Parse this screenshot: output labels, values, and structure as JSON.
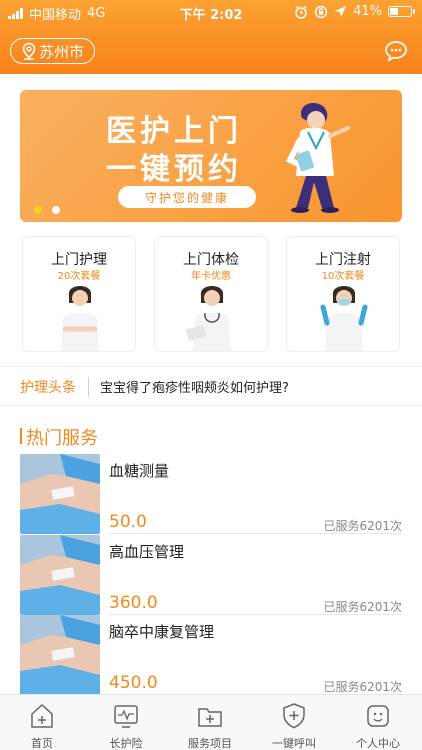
{
  "status_bar": {
    "carrier": "中国移动",
    "network": "4G",
    "time": "下午 2:02",
    "battery": "41%",
    "battery_fraction": 0.41
  },
  "header": {
    "city": "苏州市"
  },
  "banner": {
    "title_line1": "医护上门",
    "title_line2": "一键预约",
    "slogan": "守护您的健康",
    "slide_count": 2,
    "active_slide": 0
  },
  "service_cards": [
    {
      "title": "上门护理",
      "subtitle": "20次套餐"
    },
    {
      "title": "上门体检",
      "subtitle": "年卡优惠"
    },
    {
      "title": "上门注射",
      "subtitle": "10次套餐"
    }
  ],
  "headlines": {
    "tag": "护理头条",
    "text": "宝宝得了疱疹性咽颊炎如何护理?"
  },
  "hot_services": {
    "title": "热门服务",
    "items": [
      {
        "name": "血糖测量",
        "price": "50.0",
        "served": "已服务6201次"
      },
      {
        "name": "高血压管理",
        "price": "360.0",
        "served": "已服务6201次"
      },
      {
        "name": "脑卒中康复管理",
        "price": "450.0",
        "served": "已服务6201次"
      }
    ]
  },
  "tabbar": [
    {
      "label": "首页",
      "icon": "home-icon"
    },
    {
      "label": "长护险",
      "icon": "monitor-icon"
    },
    {
      "label": "服务项目",
      "icon": "folder-icon"
    },
    {
      "label": "一键呼叫",
      "icon": "shield-icon"
    },
    {
      "label": "个人中心",
      "icon": "profile-icon"
    }
  ],
  "colors": {
    "brand_orange": "#f7821a",
    "accent_text": "#f08a1c",
    "slide_active": "#f7d21a"
  }
}
